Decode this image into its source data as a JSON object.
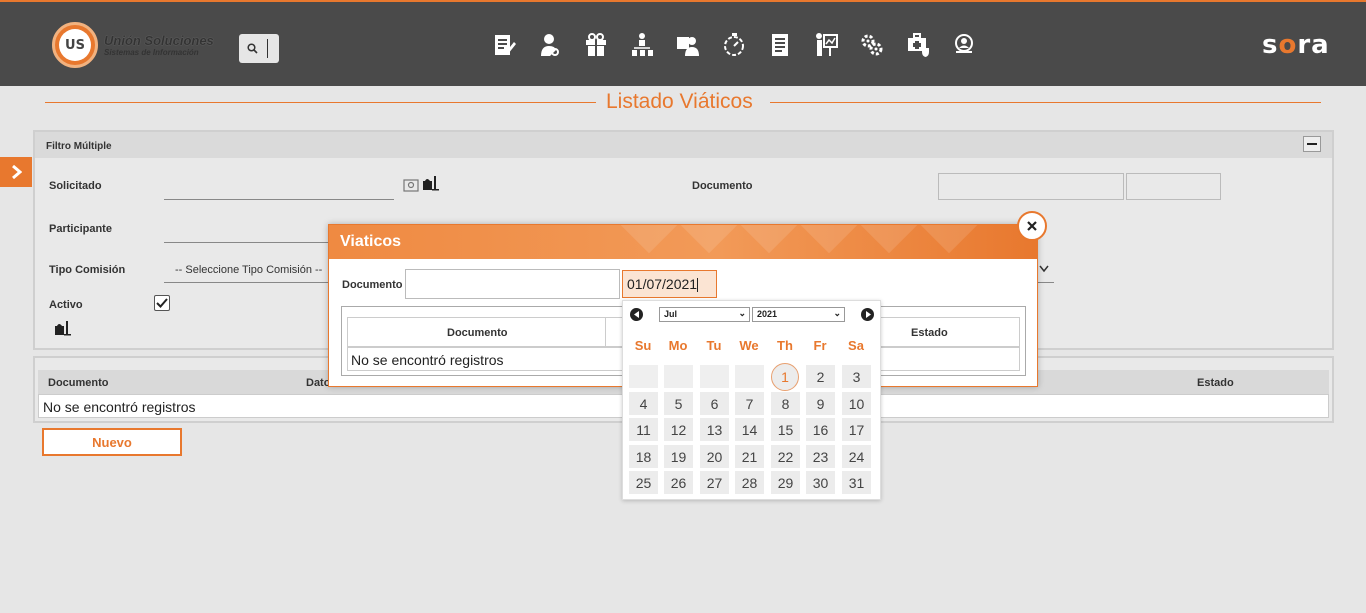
{
  "topbar": {
    "logo_mark": "US",
    "logo_title": "Unión Soluciones",
    "logo_subtitle": "Sistemas de Información",
    "brand_prefix": "s",
    "brand_mid": "o",
    "brand_suffix": "ra",
    "nav_icons": [
      "edit-doc-icon",
      "user-search-icon",
      "gift-icon",
      "hierarchy-icon",
      "user-card-icon",
      "timer-icon",
      "document-list-icon",
      "presentation-icon",
      "gears-icon",
      "medical-case-icon",
      "user-group-search-icon"
    ]
  },
  "page": {
    "title": "Listado Viáticos"
  },
  "filter": {
    "header": "Filtro Múltiple",
    "solicitado_label": "Solicitado",
    "documento_label": "Documento",
    "participante_label": "Participante",
    "tipo_comision_label": "Tipo Comisión",
    "tipo_comision_value": "-- Seleccione Tipo Comisión --",
    "activo_label": "Activo",
    "activo_checked": true
  },
  "grid": {
    "columns": [
      "Documento",
      "Dato",
      "Estado"
    ],
    "empty_message": "No se encontró registros"
  },
  "nuevo_label": "Nuevo",
  "modal": {
    "title": "Viaticos",
    "documento_label": "Documento",
    "documento_value": "",
    "date_value": "01/07/2021",
    "columns": [
      "Documento",
      "Estado"
    ],
    "empty_message": "No se encontró registros"
  },
  "datepicker": {
    "month": "Jul",
    "year": "2021",
    "weekdays": [
      "Su",
      "Mo",
      "Tu",
      "We",
      "Th",
      "Fr",
      "Sa"
    ],
    "first_weekday_index": 4,
    "days_in_month": 31,
    "selected_day": 1
  },
  "colors": {
    "accent": "#e8782e",
    "topbar": "#4a4a4a",
    "background": "#e6e6e6"
  }
}
